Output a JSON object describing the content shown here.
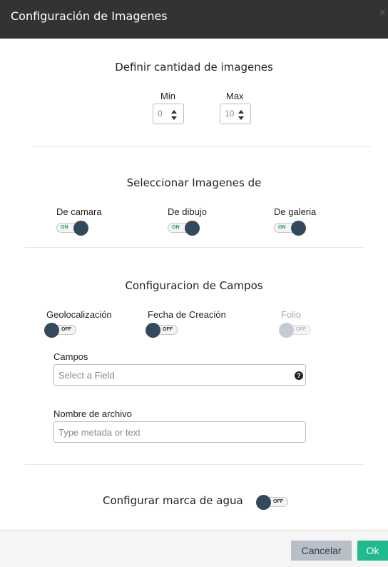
{
  "header": {
    "title": "Configuración de Imagenes",
    "close_glyph": "×"
  },
  "cantidad": {
    "title": "Definir cantidad de imagenes",
    "min": {
      "label": "Min",
      "value": "0"
    },
    "max": {
      "label": "Max",
      "value": "10"
    }
  },
  "fuentes": {
    "title": "Seleccionar Imagenes de",
    "items": [
      {
        "label": "De camara",
        "state": "ON"
      },
      {
        "label": "De dibujo",
        "state": "ON"
      },
      {
        "label": "De galeria",
        "state": "ON"
      }
    ]
  },
  "campos": {
    "title": "Configuracion de Campos",
    "items": [
      {
        "label": "Geolocalización",
        "state": "OFF"
      },
      {
        "label": "Fecha de Creación",
        "state": "OFF"
      },
      {
        "label": "Folio",
        "state": "OFF",
        "disabled": true
      }
    ],
    "campos_field": {
      "label": "Campos",
      "placeholder": "Select a Field",
      "help_glyph": "?"
    },
    "archivo_field": {
      "label": "Nombre de archivo",
      "placeholder": "Type metada or text"
    }
  },
  "marca": {
    "label": "Configurar marca de agua",
    "state": "OFF"
  },
  "footer": {
    "cancel_label": "Cancelar",
    "ok_label": "Ok"
  },
  "colors": {
    "header_bg": "#333333",
    "knob": "#34495e",
    "ok_button": "#1fba8e",
    "cancel_button": "#b8bfc6",
    "on_text": "#1e9b5a"
  }
}
